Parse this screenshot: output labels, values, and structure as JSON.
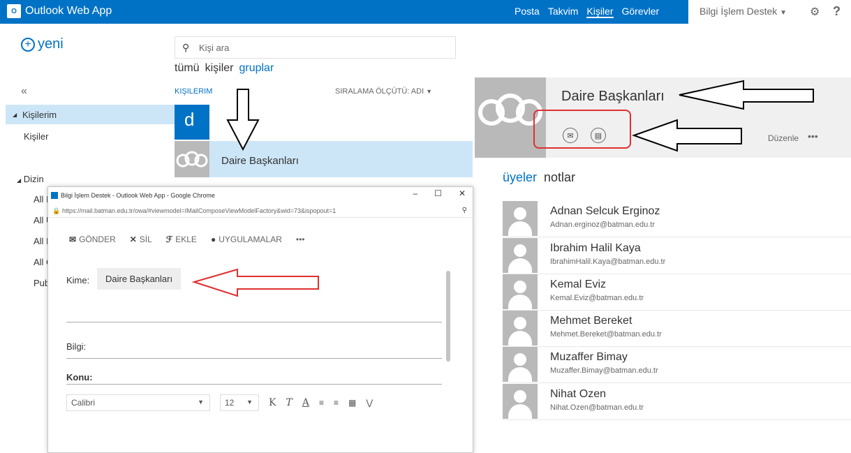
{
  "topbar": {
    "logo_badge": "O",
    "app_title": "Outlook Web App",
    "nav": [
      "Posta",
      "Takvim",
      "Kişiler",
      "Görevler"
    ],
    "active_nav": "Kişiler",
    "user": "Bilgi İşlem Destek",
    "settings_icon": "gear-icon",
    "help": "?"
  },
  "left": {
    "new_label": "yeni",
    "collapse": "«",
    "folders_header": "Kişilerim",
    "folder_items": [
      "Kişiler"
    ],
    "directory_header": "Dizin",
    "directory_items": [
      "All I",
      "All U",
      "All I",
      "All C",
      "Pub"
    ]
  },
  "list": {
    "search_placeholder": "Kişi ara",
    "filters": [
      "tümü",
      "kişiler",
      "gruplar"
    ],
    "active_filter": "gruplar",
    "section": "KIŞILERIM",
    "sort": "SIRALAMA ÖLÇÜTÜ: ADI",
    "letter": "d",
    "group_name": "Daire Başkanları"
  },
  "detail": {
    "title": "Daire Başkanları",
    "edit_label": "Düzenle",
    "more": "•••",
    "tabs": [
      "üyeler",
      "notlar"
    ],
    "members": [
      {
        "name": "Adnan Selcuk Erginoz",
        "email": "Adnan.erginoz@batman.edu.tr"
      },
      {
        "name": "Ibrahim Halil Kaya",
        "email": "IbrahimHalil.Kaya@batman.edu.tr"
      },
      {
        "name": "Kemal Eviz",
        "email": "Kemal.Eviz@batman.edu.tr"
      },
      {
        "name": "Mehmet Bereket",
        "email": "Mehmet.Bereket@batman.edu.tr"
      },
      {
        "name": "Muzaffer Bimay",
        "email": "Muzaffer.Bimay@batman.edu.tr"
      },
      {
        "name": "Nihat Ozen",
        "email": "Nihat.Ozen@batman.edu.tr"
      }
    ]
  },
  "compose": {
    "window_title": "Bilgi İşlem Destek - Outlook Web App - Google Chrome",
    "window_controls": [
      "–",
      "☐",
      "✕"
    ],
    "url": "https://mail.batman.edu.tr/owa/#viewmodel=IMailComposeViewModelFactory&wid=73&ispopout=1",
    "toolbar": [
      "GÖNDER",
      "SİL",
      "EKLE",
      "UYGULAMALAR"
    ],
    "to_label": "Kime:",
    "to_value": "Daire Başkanları",
    "cc_label": "Bilgi:",
    "subject_label": "Konu:",
    "font": "Calibri",
    "size": "12"
  }
}
